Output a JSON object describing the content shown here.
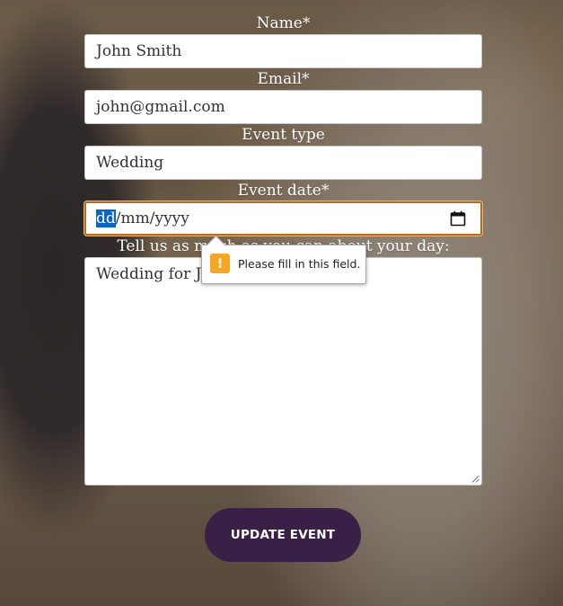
{
  "form": {
    "name_label": "Name*",
    "name_value": "John Smith",
    "email_label": "Email*",
    "email_value": "john@gmail.com",
    "event_type_label": "Event type",
    "event_type_value": "Wedding",
    "event_date_label": "Event date*",
    "event_date_day": "dd",
    "event_date_rest": "/mm/yyyy",
    "details_label": "Tell us as much as you can about your day:",
    "details_value": "Wedding for John and Jane",
    "submit_label": "UPDATE EVENT"
  },
  "validation": {
    "message": "Please fill in this field.",
    "icon": "warning-icon",
    "color": "#f5a623"
  },
  "colors": {
    "button": "#3a1f46",
    "focus_border": "#b86d1e",
    "selection": "#0a64c4"
  }
}
